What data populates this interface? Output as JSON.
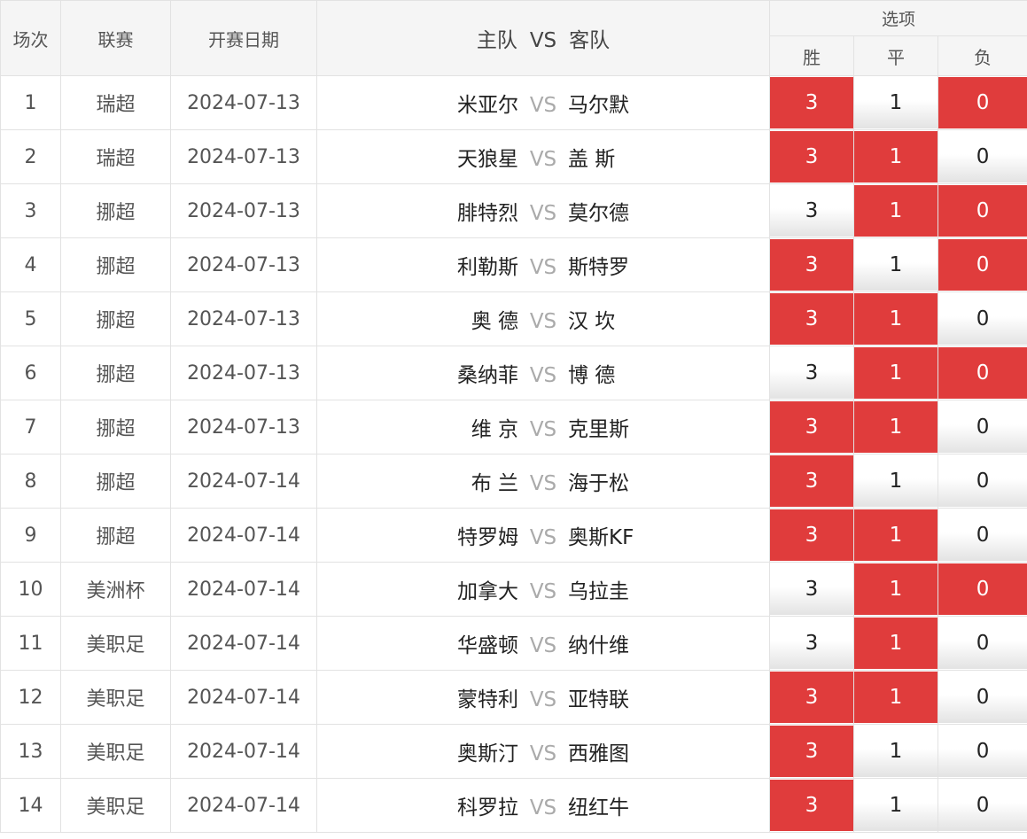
{
  "header": {
    "col_index": "场次",
    "col_league": "联赛",
    "col_date": "开赛日期",
    "col_home": "主队",
    "col_vs": "VS",
    "col_away": "客队",
    "options_group": "选项",
    "opt_win": "胜",
    "opt_draw": "平",
    "opt_loss": "负"
  },
  "vs_text": "VS",
  "colors": {
    "selected": "#e03c3c",
    "border": "#e2e2e2",
    "header_bg": "#f5f5f5"
  },
  "matches": [
    {
      "index": "1",
      "league": "瑞超",
      "date": "2024-07-13",
      "home": "米亚尔",
      "away": "马尔默",
      "win": "3",
      "draw": "1",
      "loss": "0",
      "selected": [
        true,
        false,
        true
      ]
    },
    {
      "index": "2",
      "league": "瑞超",
      "date": "2024-07-13",
      "home": "天狼星",
      "away": "盖 斯",
      "win": "3",
      "draw": "1",
      "loss": "0",
      "selected": [
        true,
        true,
        false
      ]
    },
    {
      "index": "3",
      "league": "挪超",
      "date": "2024-07-13",
      "home": "腓特烈",
      "away": "莫尔德",
      "win": "3",
      "draw": "1",
      "loss": "0",
      "selected": [
        false,
        true,
        true
      ]
    },
    {
      "index": "4",
      "league": "挪超",
      "date": "2024-07-13",
      "home": "利勒斯",
      "away": "斯特罗",
      "win": "3",
      "draw": "1",
      "loss": "0",
      "selected": [
        true,
        false,
        true
      ]
    },
    {
      "index": "5",
      "league": "挪超",
      "date": "2024-07-13",
      "home": "奥 德",
      "away": "汉 坎",
      "win": "3",
      "draw": "1",
      "loss": "0",
      "selected": [
        true,
        true,
        false
      ]
    },
    {
      "index": "6",
      "league": "挪超",
      "date": "2024-07-13",
      "home": "桑纳菲",
      "away": "博 德",
      "win": "3",
      "draw": "1",
      "loss": "0",
      "selected": [
        false,
        true,
        true
      ]
    },
    {
      "index": "7",
      "league": "挪超",
      "date": "2024-07-13",
      "home": "维 京",
      "away": "克里斯",
      "win": "3",
      "draw": "1",
      "loss": "0",
      "selected": [
        true,
        true,
        false
      ]
    },
    {
      "index": "8",
      "league": "挪超",
      "date": "2024-07-14",
      "home": "布 兰",
      "away": "海于松",
      "win": "3",
      "draw": "1",
      "loss": "0",
      "selected": [
        true,
        false,
        false
      ]
    },
    {
      "index": "9",
      "league": "挪超",
      "date": "2024-07-14",
      "home": "特罗姆",
      "away": "奥斯KF",
      "win": "3",
      "draw": "1",
      "loss": "0",
      "selected": [
        true,
        true,
        false
      ]
    },
    {
      "index": "10",
      "league": "美洲杯",
      "date": "2024-07-14",
      "home": "加拿大",
      "away": "乌拉圭",
      "win": "3",
      "draw": "1",
      "loss": "0",
      "selected": [
        false,
        true,
        true
      ]
    },
    {
      "index": "11",
      "league": "美职足",
      "date": "2024-07-14",
      "home": "华盛顿",
      "away": "纳什维",
      "win": "3",
      "draw": "1",
      "loss": "0",
      "selected": [
        false,
        true,
        false
      ]
    },
    {
      "index": "12",
      "league": "美职足",
      "date": "2024-07-14",
      "home": "蒙特利",
      "away": "亚特联",
      "win": "3",
      "draw": "1",
      "loss": "0",
      "selected": [
        true,
        true,
        false
      ]
    },
    {
      "index": "13",
      "league": "美职足",
      "date": "2024-07-14",
      "home": "奥斯汀",
      "away": "西雅图",
      "win": "3",
      "draw": "1",
      "loss": "0",
      "selected": [
        true,
        false,
        false
      ]
    },
    {
      "index": "14",
      "league": "美职足",
      "date": "2024-07-14",
      "home": "科罗拉",
      "away": "纽红牛",
      "win": "3",
      "draw": "1",
      "loss": "0",
      "selected": [
        true,
        false,
        false
      ]
    }
  ]
}
